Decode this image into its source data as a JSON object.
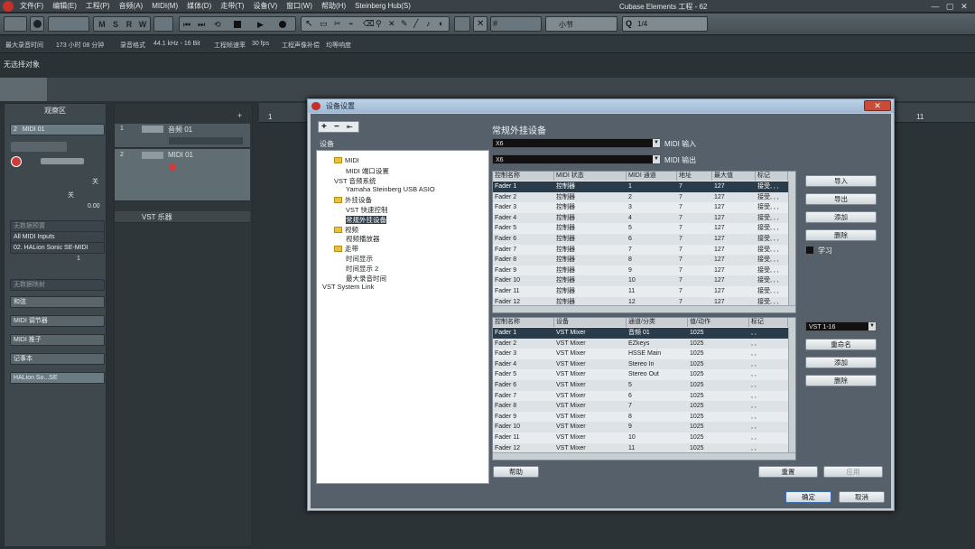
{
  "menubar": {
    "items": [
      "文件(F)",
      "编辑(E)",
      "工程(P)",
      "音频(A)",
      "MIDI(M)",
      "媒体(D)",
      "走带(T)",
      "设备(V)",
      "窗口(W)",
      "帮助(H)",
      "Steinberg Hub(S)"
    ],
    "title": "Cubase Elements 工程 - 62",
    "win_min": "—",
    "win_max": "▢",
    "win_close": "✕"
  },
  "toolbar": {
    "m": "M",
    "s": "S",
    "r": "R",
    "w": "W",
    "quantize_label": "1/4",
    "grid_label": "小节"
  },
  "infobar": {
    "max_record_time_label": "最大录音时间",
    "max_record_time": "173 小时 08 分钟",
    "record_format_label": "录音格式",
    "record_format": "44.1 kHz - 16 Bit",
    "frame_rate_label": "工程帧速率",
    "frame_rate": "30 fps",
    "pan_law_label": "工程声像补偿",
    "pan_law": "均等响度"
  },
  "status": {
    "no_selection": "无选择对象"
  },
  "inspector": {
    "header": "观察区",
    "track_name": "MIDI 01",
    "track_number": "2",
    "off1": "关",
    "off2": "关",
    "value": "0.00",
    "no_bank": "无数据预置",
    "midi_inputs": "All MIDI Inputs",
    "midi_output": "02. HALion Sonic SE-MIDI",
    "channel": "1",
    "no_bank2": "无数据映射",
    "sections": [
      "和弦",
      "MIDI 调节器",
      "MIDI 推子",
      "记事本"
    ],
    "instrument": "HALion So...SE"
  },
  "tracklist": {
    "add": "+",
    "tracks": [
      {
        "num": "1",
        "name": "音频 01"
      },
      {
        "num": "2",
        "name": "MIDI 01"
      }
    ],
    "folder": "VST 乐器"
  },
  "ruler": {
    "start": "1",
    "end": "11"
  },
  "dialog": {
    "title": "设备设置",
    "close": "✕",
    "toolbar_add": "+",
    "toolbar_remove": "−",
    "toolbar_reset": "⇤",
    "tree_header": "设备",
    "tree": [
      {
        "label": "MIDI",
        "folder": true,
        "level": 1
      },
      {
        "label": "MIDI 端口设置",
        "folder": false,
        "level": 2
      },
      {
        "label": "VST 音频系统",
        "folder": false,
        "level": 1
      },
      {
        "label": "Yamaha Steinberg USB ASIO",
        "folder": false,
        "level": 2
      },
      {
        "label": "外挂设备",
        "folder": true,
        "level": 1
      },
      {
        "label": "VST 快速控制",
        "folder": false,
        "level": 2
      },
      {
        "label": "常规外挂设备",
        "folder": false,
        "level": 2,
        "selected": true
      },
      {
        "label": "视频",
        "folder": true,
        "level": 1
      },
      {
        "label": "视频播放器",
        "folder": false,
        "level": 2
      },
      {
        "label": "走带",
        "folder": true,
        "level": 1
      },
      {
        "label": "时间显示",
        "folder": false,
        "level": 2
      },
      {
        "label": "时间显示 2",
        "folder": false,
        "level": 2
      },
      {
        "label": "最大录音时间",
        "folder": false,
        "level": 2
      },
      {
        "label": "VST System Link",
        "folder": false,
        "level": 0
      }
    ],
    "section_title": "常规外挂设备",
    "midi_in_value": "X6",
    "midi_in_label": "MIDI 输入",
    "midi_out_value": "X6",
    "midi_out_label": "MIDI 输出",
    "table1": {
      "headers": [
        "控制名称",
        "MIDI 状态",
        "MIDI 通道",
        "地址",
        "最大值",
        "标记"
      ],
      "rows": [
        [
          "Fader 1",
          "控制器",
          "1",
          "7",
          "127",
          "接受, , ,"
        ],
        [
          "Fader 2",
          "控制器",
          "2",
          "7",
          "127",
          "接受, , ,"
        ],
        [
          "Fader 3",
          "控制器",
          "3",
          "7",
          "127",
          "接受, , ,"
        ],
        [
          "Fader 4",
          "控制器",
          "4",
          "7",
          "127",
          "接受, , ,"
        ],
        [
          "Fader 5",
          "控制器",
          "5",
          "7",
          "127",
          "接受, , ,"
        ],
        [
          "Fader 6",
          "控制器",
          "6",
          "7",
          "127",
          "接受, , ,"
        ],
        [
          "Fader 7",
          "控制器",
          "7",
          "7",
          "127",
          "接受, , ,"
        ],
        [
          "Fader 8",
          "控制器",
          "8",
          "7",
          "127",
          "接受, , ,"
        ],
        [
          "Fader 9",
          "控制器",
          "9",
          "7",
          "127",
          "接受, , ,"
        ],
        [
          "Fader 10",
          "控制器",
          "10",
          "7",
          "127",
          "接受, , ,"
        ],
        [
          "Fader 11",
          "控制器",
          "11",
          "7",
          "127",
          "接受, , ,"
        ],
        [
          "Fader 12",
          "控制器",
          "12",
          "7",
          "127",
          "接受, , ,"
        ]
      ]
    },
    "table2": {
      "headers": [
        "控制名称",
        "设备",
        "通道/分类",
        "值/动作",
        "标记"
      ],
      "rows": [
        [
          "Fader 1",
          "VST Mixer",
          "音频 01",
          "1025",
          ", ,"
        ],
        [
          "Fader 2",
          "VST Mixer",
          "EZkeys",
          "1025",
          ", ,"
        ],
        [
          "Fader 3",
          "VST Mixer",
          "HSSE Main",
          "1025",
          ", ,"
        ],
        [
          "Fader 4",
          "VST Mixer",
          "Stereo In",
          "1025",
          ", ,"
        ],
        [
          "Fader 5",
          "VST Mixer",
          "Stereo Out",
          "1025",
          ", ,"
        ],
        [
          "Fader 6",
          "VST Mixer",
          "5",
          "1025",
          ", ,"
        ],
        [
          "Fader 7",
          "VST Mixer",
          "6",
          "1025",
          ", ,"
        ],
        [
          "Fader 8",
          "VST Mixer",
          "7",
          "1025",
          ", ,"
        ],
        [
          "Fader 9",
          "VST Mixer",
          "8",
          "1025",
          ", ,"
        ],
        [
          "Fader 10",
          "VST Mixer",
          "9",
          "1025",
          ", ,"
        ],
        [
          "Fader 11",
          "VST Mixer",
          "10",
          "1025",
          ", ,"
        ],
        [
          "Fader 12",
          "VST Mixer",
          "11",
          "1025",
          ", ,"
        ]
      ]
    },
    "right_buttons_top": [
      "导入",
      "导出",
      "添加",
      "删除"
    ],
    "learn_label": "学习",
    "bank_value": "VST 1-16",
    "right_buttons_bottom": [
      "重命名",
      "添加",
      "删除"
    ],
    "help": "帮助",
    "reset": "重置",
    "apply": "应用",
    "ok": "确定",
    "cancel": "取消"
  }
}
